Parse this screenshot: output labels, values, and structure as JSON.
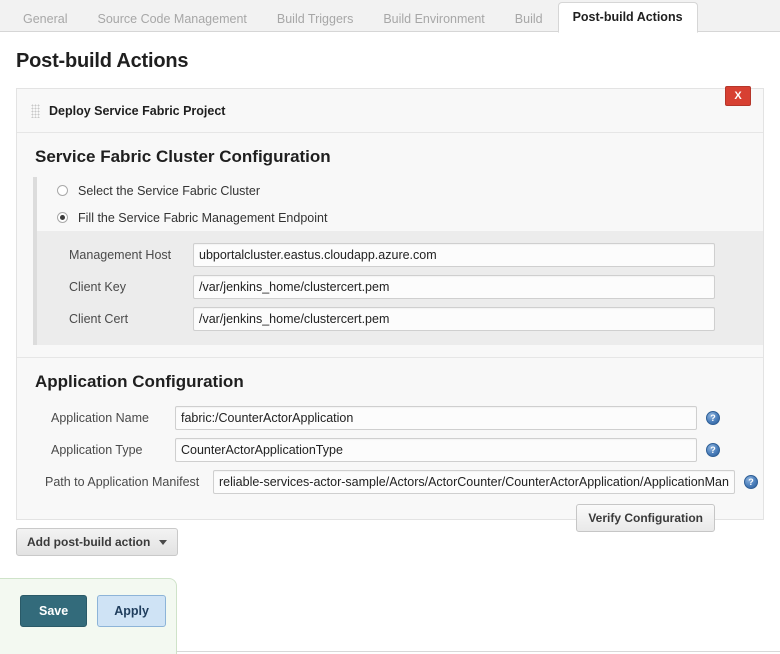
{
  "tabs": [
    {
      "label": "General",
      "active": false
    },
    {
      "label": "Source Code Management",
      "active": false
    },
    {
      "label": "Build Triggers",
      "active": false
    },
    {
      "label": "Build Environment",
      "active": false
    },
    {
      "label": "Build",
      "active": false
    },
    {
      "label": "Post-build Actions",
      "active": true
    }
  ],
  "page": {
    "title": "Post-build Actions"
  },
  "block": {
    "title": "Deploy Service Fabric Project",
    "grip_icon": "drag-handle-icon",
    "close_label": "X"
  },
  "cluster_section": {
    "title": "Service Fabric Cluster Configuration",
    "radios": [
      {
        "label": "Select the Service Fabric Cluster",
        "checked": false
      },
      {
        "label": "Fill the Service Fabric Management Endpoint",
        "checked": true
      }
    ],
    "fields": [
      {
        "label": "Management Host",
        "value": "ubportalcluster.eastus.cloudapp.azure.com"
      },
      {
        "label": "Client Key",
        "value": "/var/jenkins_home/clustercert.pem"
      },
      {
        "label": "Client Cert",
        "value": "/var/jenkins_home/clustercert.pem"
      }
    ]
  },
  "app_section": {
    "title": "Application Configuration",
    "fields": [
      {
        "label": "Application Name",
        "value": "fabric:/CounterActorApplication",
        "help": "help-icon"
      },
      {
        "label": "Application Type",
        "value": "CounterActorApplicationType",
        "help": "help-icon"
      },
      {
        "label": "Path to Application Manifest",
        "value": "reliable-services-actor-sample/Actors/ActorCounter/CounterActorApplication/ApplicationManifest.xml",
        "help": "help-icon"
      }
    ],
    "verify_label": "Verify Configuration"
  },
  "add_action": {
    "label": "Add post-build action",
    "caret": "chevron-down-icon"
  },
  "footer": {
    "save_label": "Save",
    "apply_label": "Apply"
  },
  "colors": {
    "accent_save": "#336b7b",
    "accent_apply": "#cfe3f5",
    "close_red": "#d74032",
    "help_blue": "#4a7ebb",
    "footer_green": "#f3f9f1"
  }
}
